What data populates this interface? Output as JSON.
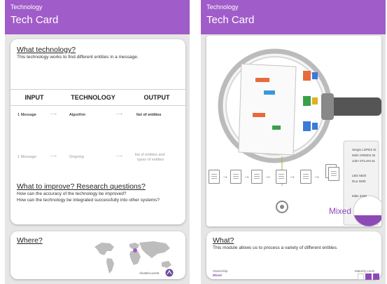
{
  "left_screen": {
    "header": {
      "crumb": "Technology",
      "title": "Tech Card"
    },
    "what_card": {
      "heading": "What technology?",
      "description": "This technology works to find different entities in a message.",
      "table": {
        "headers": [
          "INPUT",
          "TECHNOLOGY",
          "OUTPUT"
        ],
        "rows": [
          {
            "input": "1 Message",
            "technology": "Algorithm",
            "output": "list of entities",
            "arrow": "⟶"
          },
          {
            "input": "1 Message",
            "technology": "Ongoing",
            "output_line1": "list of entities and",
            "output_line2": "types of entities",
            "arrow": "⟶"
          }
        ]
      },
      "improve_heading": "What to improve? Research questions?",
      "questions": [
        "How can the accuracy of the technology be improved?",
        "How can the technology be integrated successfully into other systems?"
      ]
    },
    "where_card": {
      "heading": "Where?",
      "caption": "Alcatel-Lucent"
    }
  },
  "right_screen": {
    "header": {
      "crumb": "Technology",
      "title": "Tech Card"
    },
    "illustration": {
      "doc_lines": [
        "This is...",
        "the tech...",
        "used in the industry?",
        "The ... in the",
        "method are ..."
      ],
      "contacts": [
        "Sergio LOPEZ SI",
        "Minh GREEN 32",
        "John STLAIN 31",
        "LBO 5920",
        "Duo 3280",
        "Mike 3420"
      ],
      "mixed_label": "Mixed"
    },
    "what_card": {
      "heading": "What?",
      "description": "This module allows us to process a variety of different entities.",
      "ownership_label": "Ownership",
      "ownership_value": "Mixed",
      "maturity_label": "Maturity Level"
    }
  },
  "colors": {
    "accent": "#a05cc8",
    "background": "#e6e6e6",
    "card": "#ffffff"
  }
}
